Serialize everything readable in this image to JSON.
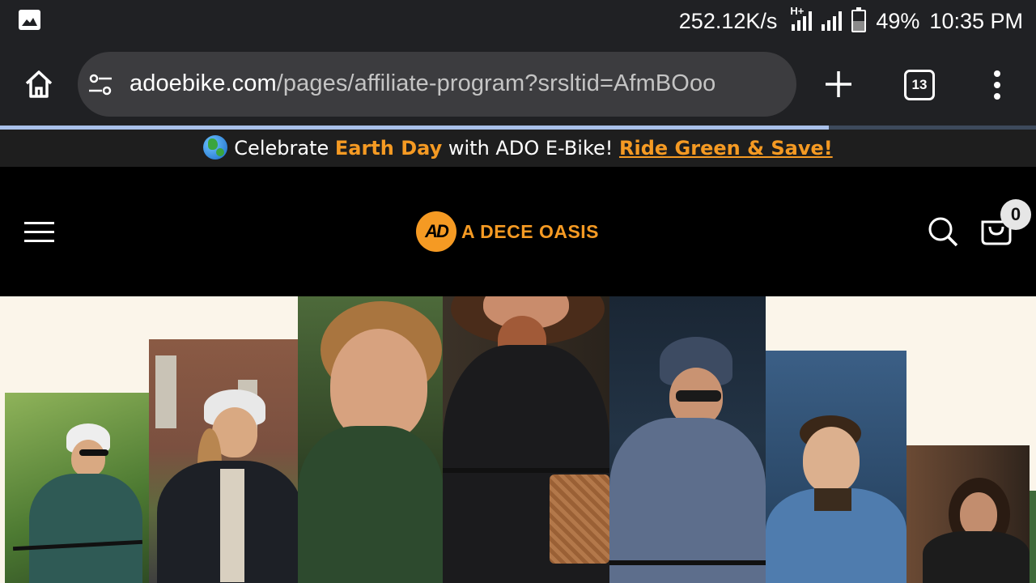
{
  "status_bar": {
    "network_speed": "252.12K/s",
    "network_type": "H+",
    "battery_percent": "49%",
    "battery_level": 0.49,
    "time": "10:35 PM",
    "notification_icon": "gallery-icon"
  },
  "browser": {
    "url_domain": "adoebike.com",
    "url_path": "/pages/affiliate-program?srsltid=AfmBOoo",
    "tab_count": "13",
    "load_progress": 0.8,
    "icons": [
      "home-icon",
      "page-info-icon",
      "new-tab-icon",
      "tab-switcher-icon",
      "more-vert-icon"
    ]
  },
  "announcement": {
    "prefix": "Celebrate ",
    "highlight": "Earth Day",
    "middle": " with ADO E-Bike! ",
    "cta": "Ride Green & Save!",
    "icon": "globe-icon"
  },
  "header": {
    "logo_mark": "AD",
    "logo_text": "A DECE OASIS",
    "cart_count": "0",
    "icons": [
      "menu-icon",
      "search-icon",
      "cart-icon"
    ]
  },
  "colors": {
    "brand_orange": "#f59a23",
    "hero_background": "#fbf5ea",
    "browser_chrome": "#202124"
  }
}
